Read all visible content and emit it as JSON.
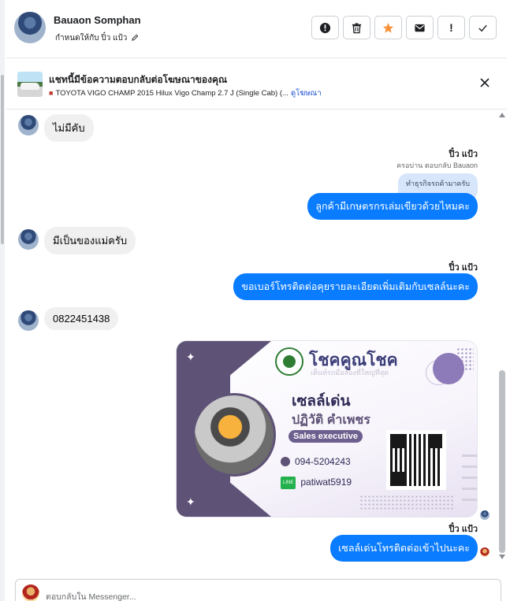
{
  "header": {
    "contact_name": "Bauaon Somphan",
    "assigned_to": "กำหนดให้กับ ปิ๋ว แป้ว",
    "actions": [
      {
        "icon": "alert-circle-icon",
        "label": ""
      },
      {
        "icon": "trash-icon",
        "label": ""
      },
      {
        "icon": "star-icon",
        "label": ""
      },
      {
        "icon": "envelope-icon",
        "label": ""
      },
      {
        "icon": "exclamation-icon",
        "label": "!"
      },
      {
        "icon": "check-icon",
        "label": ""
      }
    ],
    "star_color": "#f7923a"
  },
  "ad_context": {
    "title": "แชทนี้มีข้อความตอบกลับต่อโฆษณาของคุณ",
    "subtitle": "TOYOTA VIGO CHAMP 2015 Hilux Vigo Champ 2.7 J (Single Cab) (...",
    "link": "ดูโฆษณา"
  },
  "messages": {
    "m1": {
      "text": "ไม่มีคับ"
    },
    "m2": {
      "sender": "ปิ๋ว แป้ว",
      "reply_note": "ครอบ่าน ตอบกลับ Bauaon",
      "quoted": "ทำธุรกิจรถค้ามาครับ",
      "text": "ลูกค้ามีเกษตรกรเล่มเขียวด้วยไหมคะ"
    },
    "m3": {
      "text": "มีเป็นของแม่ครับ"
    },
    "m4": {
      "sender": "ปิ๋ว แป้ว",
      "text": "ขอเบอร์โทรติดต่อคุยรายละเอียดเพิ่มเติมกับเซลล์นะคะ"
    },
    "m5": {
      "text": "0822451438"
    },
    "card": {
      "brand": "โชคคูณโชค",
      "slogan": "เต็นท์รถมือสองที่ใหญ่ที่สุด",
      "nickname": "เซลล์เด่น",
      "full_name": "ปฏิวัติ คำเพชร",
      "role": "Sales executive",
      "phone": "094-5204243",
      "line_label": "LINE",
      "line_id": "patiwat5919"
    },
    "m6": {
      "sender": "ปิ๋ว แป้ว",
      "text": "เซลล์เด่นโทรติดต่อเข้าไปนะคะ"
    }
  },
  "composer": {
    "placeholder": "ตอบกลับใน Messenger..."
  },
  "colors": {
    "outgoing_bubble": "#0a7cff",
    "incoming_bubble": "#f0f0f0",
    "link": "#1a4fd0"
  }
}
